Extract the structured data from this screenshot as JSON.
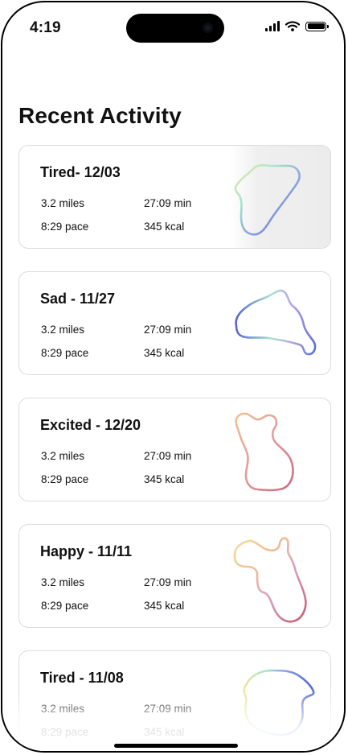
{
  "status_bar": {
    "time": "4:19"
  },
  "page": {
    "title": "Recent Activity"
  },
  "activities": [
    {
      "title": "Tired- 12/03",
      "distance": "3.2 miles",
      "duration": "27:09 min",
      "pace": "8:29 pace",
      "calories": "345 kcal",
      "highlighted": true
    },
    {
      "title": "Sad - 11/27",
      "distance": "3.2 miles",
      "duration": "27:09 min",
      "pace": "8:29 pace",
      "calories": "345 kcal"
    },
    {
      "title": "Excited - 12/20",
      "distance": "3.2 miles",
      "duration": "27:09 min",
      "pace": "8:29 pace",
      "calories": "345 kcal"
    },
    {
      "title": "Happy - 11/11",
      "distance": "3.2 miles",
      "duration": "27:09 min",
      "pace": "8:29 pace",
      "calories": "345 kcal"
    },
    {
      "title": "Tired - 11/08",
      "distance": "3.2 miles",
      "duration": "27:09 min",
      "pace": "8:29 pace",
      "calories": "345 kcal"
    }
  ],
  "colors": {
    "route_blue": "#5b6fd6",
    "route_purple": "#8a78d8",
    "route_mint": "#a8e6cf",
    "route_yellow": "#f1e59a",
    "route_rose": "#d9707c",
    "route_peach": "#f3c08f"
  }
}
